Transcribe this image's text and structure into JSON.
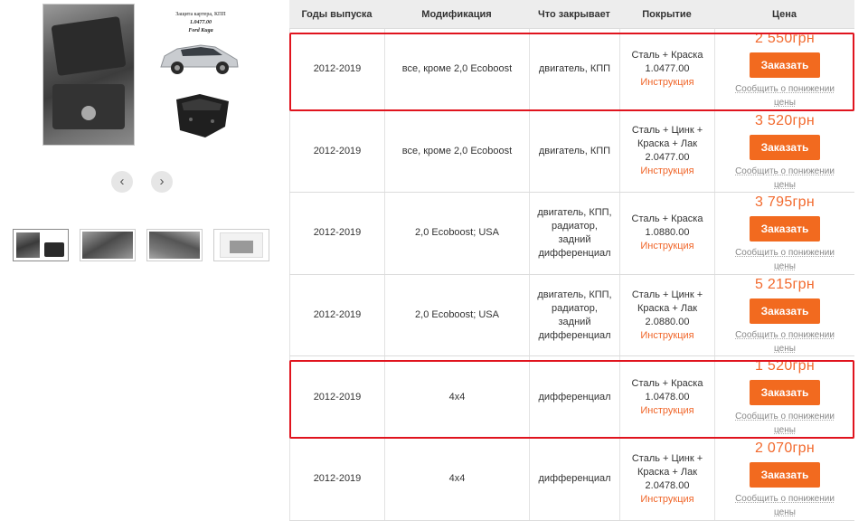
{
  "gallery": {
    "caption_line1": "Защита картера, КПП",
    "caption_line2": "1.0477.00",
    "caption_line3": "Ford Kuga",
    "prev_icon": "chevron-left-icon",
    "next_icon": "chevron-right-icon",
    "thumbnails": [
      "thumb-1",
      "thumb-2",
      "thumb-3",
      "thumb-4"
    ]
  },
  "table": {
    "headers": [
      "Годы выпуска",
      "Модификация",
      "Что закрывает",
      "Покрытие",
      "Цена"
    ],
    "rows": [
      {
        "years": "2012-2019",
        "modification": "все, кроме 2,0 Ecoboost",
        "covers": "двигатель, КПП",
        "coating": "Сталь + Краска",
        "code": "1.0477.00",
        "instruction": "Инструкция",
        "price": "2 550грн",
        "order": "Заказать",
        "notify": "Сообщить о понижении цены",
        "highlighted": true
      },
      {
        "years": "2012-2019",
        "modification": "все, кроме 2,0 Ecoboost",
        "covers": "двигатель, КПП",
        "coating": "Сталь + Цинк + Краска + Лак",
        "code": "2.0477.00",
        "instruction": "Инструкция",
        "price": "3 520грн",
        "order": "Заказать",
        "notify": "Сообщить о понижении цены",
        "highlighted": false
      },
      {
        "years": "2012-2019",
        "modification": "2,0 Ecoboost; USA",
        "covers": "двигатель, КПП, радиатор, задний дифференциал",
        "coating": "Сталь + Краска",
        "code": "1.0880.00",
        "instruction": "Инструкция",
        "price": "3 795грн",
        "order": "Заказать",
        "notify": "Сообщить о понижении цены",
        "highlighted": false
      },
      {
        "years": "2012-2019",
        "modification": "2,0 Ecoboost; USA",
        "covers": "двигатель, КПП, радиатор, задний дифференциал",
        "coating": "Сталь + Цинк + Краска + Лак",
        "code": "2.0880.00",
        "instruction": "Инструкция",
        "price": "5 215грн",
        "order": "Заказать",
        "notify": "Сообщить о понижении цены",
        "highlighted": false
      },
      {
        "years": "2012-2019",
        "modification": "4x4",
        "covers": "дифференциал",
        "coating": "Сталь + Краска",
        "code": "1.0478.00",
        "instruction": "Инструкция",
        "price": "1 520грн",
        "order": "Заказать",
        "notify": "Сообщить о понижении цены",
        "highlighted": true
      },
      {
        "years": "2012-2019",
        "modification": "4x4",
        "covers": "дифференциал",
        "coating": "Сталь + Цинк + Краска + Лак",
        "code": "2.0478.00",
        "instruction": "Инструкция",
        "price": "2 070грн",
        "order": "Заказать",
        "notify": "Сообщить о понижении цены",
        "highlighted": false
      }
    ]
  },
  "colors": {
    "accent": "#f26a1f",
    "price": "#f26a2e",
    "highlight_border": "#e0141e",
    "header_bg": "#ededed"
  }
}
